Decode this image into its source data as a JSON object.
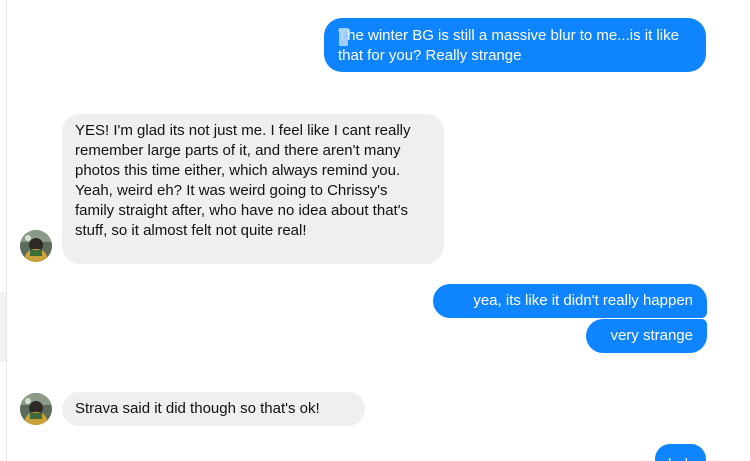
{
  "conversation": {
    "messages": [
      {
        "direction": "outgoing",
        "text": "The winter BG is still a massive blur to me...is it like that for you? Really strange"
      },
      {
        "direction": "incoming",
        "text": "YES! I'm glad its not just me.  I feel like I cant really remember large parts of it, and there aren't many photos this time either, which always remind you.  Yeah, weird eh? It was weird going to Chrissy's family straight after, who have no idea about that's stuff, so it almost felt not quite real!"
      },
      {
        "direction": "outgoing",
        "text": "yea, its like it didn't really happen"
      },
      {
        "direction": "outgoing",
        "text": "very strange"
      },
      {
        "direction": "incoming",
        "text": "Strava said it did though so that's ok!"
      },
      {
        "direction": "outgoing",
        "text": "haha"
      }
    ]
  },
  "colors": {
    "outgoing_bubble": "#0f84ff",
    "incoming_bubble": "#efefef",
    "text_caret_highlight": "#add6ff"
  },
  "icons": {
    "avatar": "contact-profile-photo"
  }
}
